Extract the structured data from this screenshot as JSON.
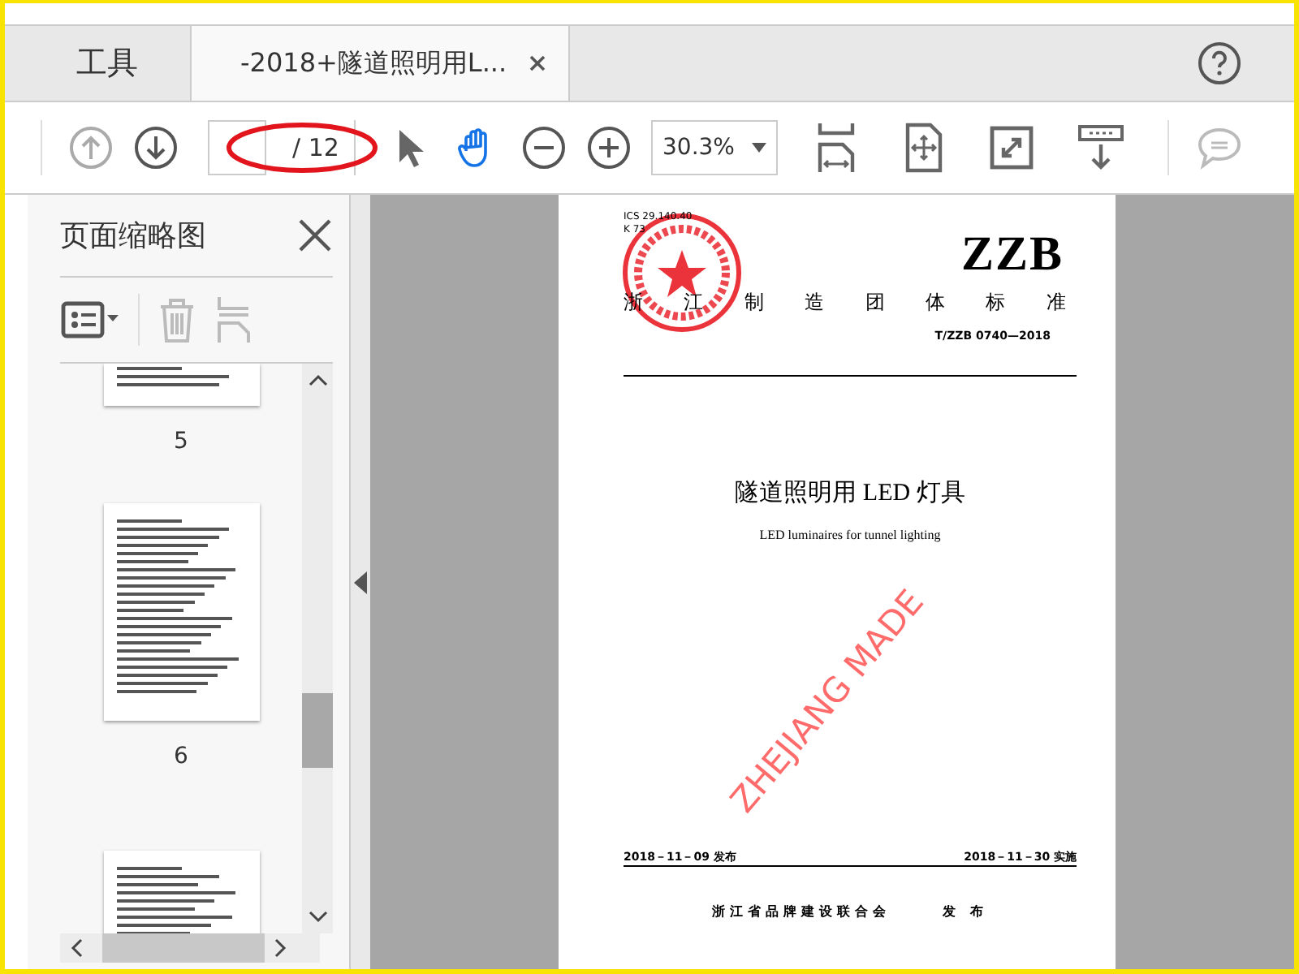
{
  "tabs": [
    {
      "label": "工具",
      "selected": false
    },
    {
      "label": "-2018+隧道照明用L...",
      "selected": true
    }
  ],
  "toolbar": {
    "page_total": "/ 12",
    "zoom": "30.3%",
    "tools": [
      {
        "kind": "select",
        "selected": false
      },
      {
        "kind": "hand",
        "selected": true
      }
    ]
  },
  "sidebar": {
    "title": "页面缩略图",
    "page_labels": [
      "5",
      "6"
    ]
  },
  "document": {
    "ics": "ICS 29.140.40",
    "ccs": "K 73",
    "mark": "ZZB",
    "org_heading": "浙江制造团体标准",
    "code": "T/ZZB 0740—2018",
    "title": "隧道照明用 LED 灯具",
    "title_en": "LED luminaires for tunnel lighting",
    "issue_date": "2018－11－09 发布",
    "impl_date": "2018－11－30 实施",
    "publisher": "浙江省品牌建设联合会",
    "publish_word": "发 布",
    "watermark": "ZHEJIANG MADE"
  }
}
